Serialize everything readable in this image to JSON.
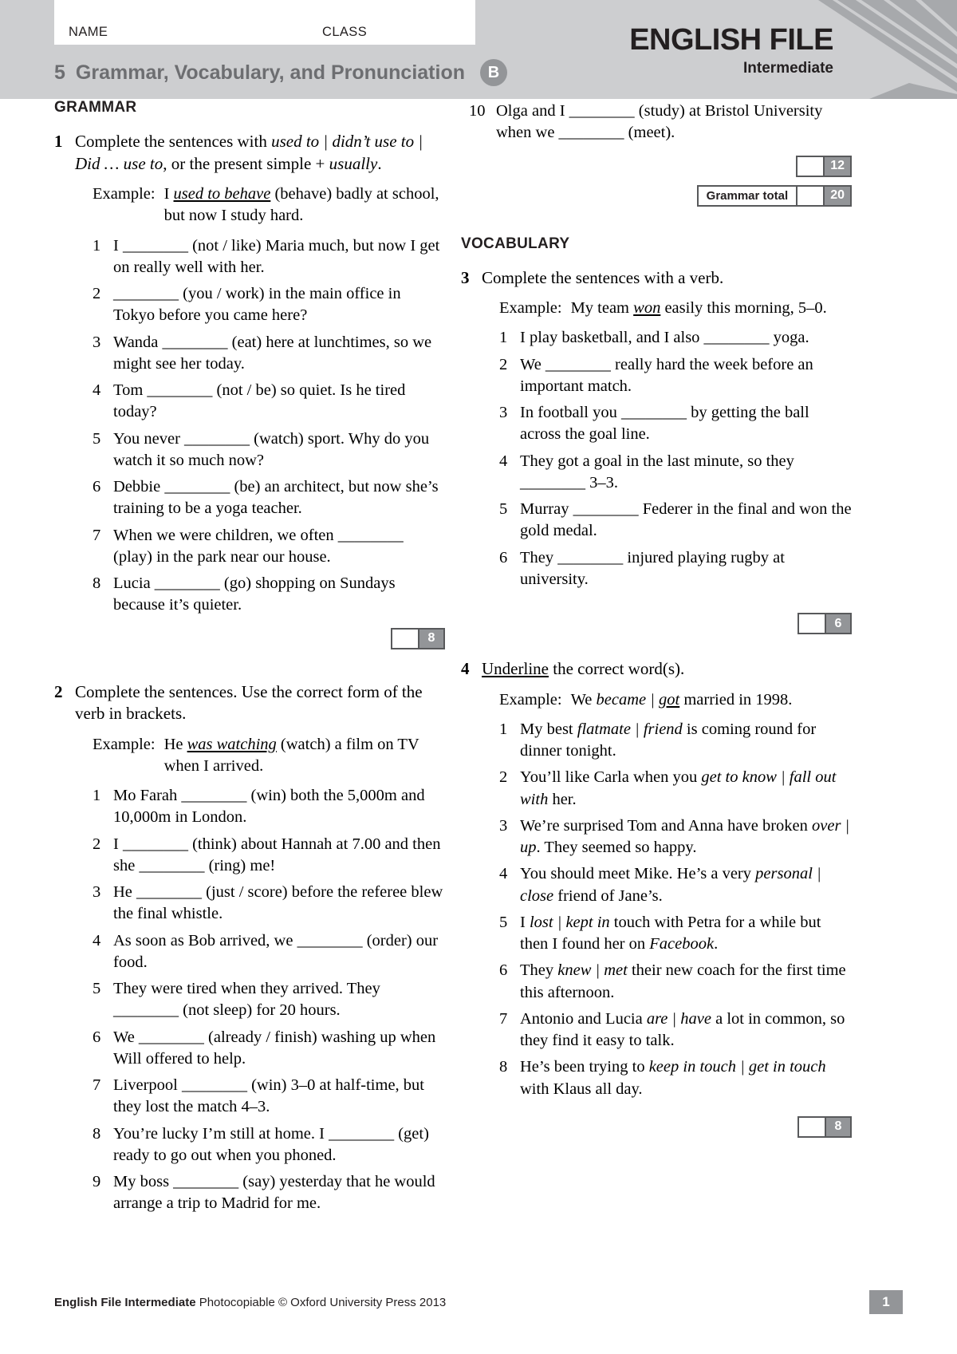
{
  "header": {
    "name_label": "NAME",
    "class_label": "CLASS",
    "test_number": "5",
    "title": "Grammar, Vocabulary, and Pronunciation",
    "version_badge": "B",
    "brand_main": "ENGLISH FILE",
    "brand_sub": "Intermediate"
  },
  "sections": {
    "grammar_heading": "GRAMMAR",
    "vocabulary_heading": "VOCABULARY"
  },
  "exercise1": {
    "number": "1",
    "rubric_parts": {
      "a": "Complete the sentences with ",
      "b": "used to | didn’t use to | Did … use to",
      "c": ", or the present simple + ",
      "d": "usually",
      "e": "."
    },
    "example_label": "Example:",
    "example_pre": "I ",
    "example_answer": "used to behave",
    "example_post": " (behave) badly at school, but now I study hard.",
    "items": [
      "I ________ (not / like) Maria much, but now I get on really well with her.",
      "________ (you / work) in the main office in Tokyo before you came here?",
      "Wanda ________ (eat) here at lunchtimes, so we might see her today.",
      "Tom ________ (not / be) so quiet. Is he tired today?",
      "You never ________ (watch) sport. Why do you watch it so much now?",
      "Debbie ________ (be) an architect, but now she’s training to be a yoga teacher.",
      "When we were children, we often ________ (play) in the park near our house.",
      "Lucia ________ (go) shopping on Sundays because it’s quieter."
    ],
    "score": "8"
  },
  "exercise2": {
    "number": "2",
    "rubric": "Complete the sentences. Use the correct form of the verb in brackets.",
    "example_label": "Example:",
    "example_pre": "He ",
    "example_answer": "was watching",
    "example_post": " (watch) a film on TV when I arrived.",
    "items": [
      "Mo Farah ________ (win) both the 5,000m and 10,000m in London.",
      "I ________ (think) about Hannah at 7.00 and then she ________ (ring) me!",
      "He ________ (just / score) before the referee blew the final whistle.",
      "As soon as Bob arrived, we ________ (order) our food.",
      "They were tired when they arrived. They ________ (not sleep) for 20 hours.",
      "We ________ (already / finish) washing up when Will offered to help.",
      "Liverpool ________ (win) 3–0 at half-time, but they lost the match 4–3.",
      "You’re lucky I’m still at home. I ________ (get) ready to go out when you phoned.",
      "My boss ________ (say) yesterday that he would arrange a trip to Madrid for me.",
      "Olga and I ________ (study) at Bristol University when we ________ (meet)."
    ],
    "score": "12",
    "total_label": "Grammar total",
    "total_value": "20"
  },
  "exercise3": {
    "number": "3",
    "rubric": "Complete the sentences with a verb.",
    "example_label": "Example:",
    "example_pre": "My team ",
    "example_answer": "won",
    "example_post": " easily this morning, 5–0.",
    "items": [
      "I play basketball, and I also ________ yoga.",
      "We ________ really hard the week before an important match.",
      "In football you ________ by getting the ball across the goal line.",
      "They got a goal in the last minute, so they ________ 3–3.",
      "Murray ________ Federer in the final and won the gold medal.",
      "They ________ injured playing rugby at university."
    ],
    "score": "6"
  },
  "exercise4": {
    "number": "4",
    "rubric_underlined": "Underline",
    "rubric_rest": " the correct word(s).",
    "example_label": "Example:",
    "example_pre": "We ",
    "example_italic": "became | ",
    "example_answer": "got",
    "example_post": " married in 1998.",
    "items": [
      {
        "pre": "My best ",
        "choice": "flatmate | friend",
        "post": " is coming round for dinner tonight."
      },
      {
        "pre": "You’ll like Carla when you ",
        "choice": "get to know | fall out with",
        "post": " her."
      },
      {
        "pre": "We’re surprised Tom and Anna have broken ",
        "choice": "over | up",
        "post": ". They seemed so happy."
      },
      {
        "pre": "You should meet Mike. He’s a very ",
        "choice": "personal | close",
        "post": " friend of Jane’s."
      },
      {
        "pre": "I ",
        "choice": "lost | kept in",
        "post": " touch with Petra for a while but then I found her on ",
        "post_italic": "Facebook",
        "post_end": "."
      },
      {
        "pre": "They ",
        "choice": "knew | met",
        "post": " their new coach for the first time this afternoon."
      },
      {
        "pre": "Antonio and Lucia ",
        "choice": "are | have",
        "post": " a lot in common, so they find it easy to talk."
      },
      {
        "pre": "He’s been trying to ",
        "choice": "keep in touch | get in touch",
        "post": " with Klaus all day."
      }
    ],
    "score": "8"
  },
  "footer": {
    "brand": "English File Intermediate",
    "copyright": " Photocopiable © Oxford University Press 2013",
    "page_number": "1"
  }
}
